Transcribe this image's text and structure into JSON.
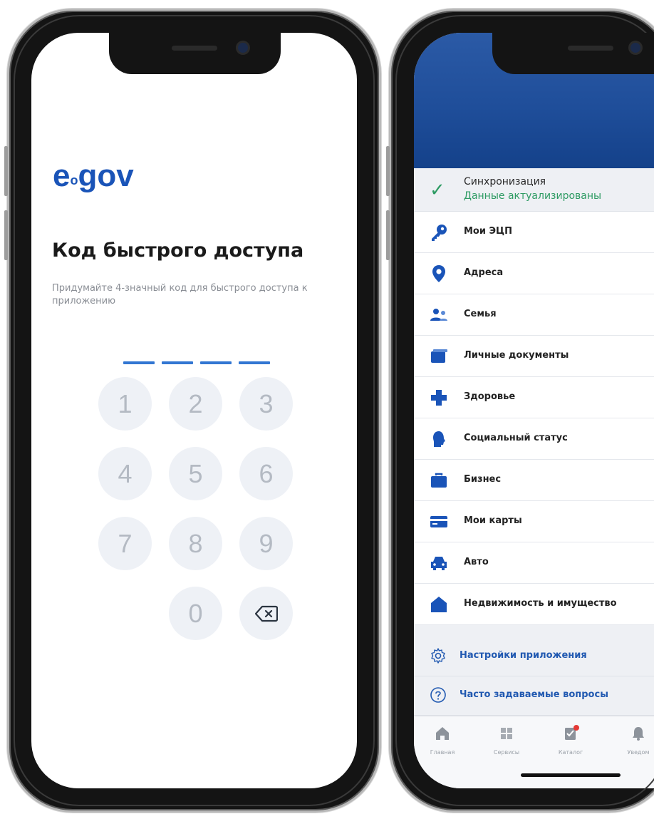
{
  "left_screen": {
    "logo_main": "e",
    "logo_sub": "o",
    "logo_tail": "gov",
    "title": "Код быстрого доступа",
    "description": "Придумайте 4-значный код для быстрого доступа к приложению",
    "pin_length": 4,
    "keypad": {
      "k1": "1",
      "k2": "2",
      "k3": "3",
      "k4": "4",
      "k5": "5",
      "k6": "6",
      "k7": "7",
      "k8": "8",
      "k9": "9",
      "k0": "0",
      "backspace_icon": "backspace-icon"
    },
    "colors": {
      "accent": "#1a54b8",
      "dash": "#3276d2",
      "key_bg": "#eef1f6",
      "key_text": "#b4bac3"
    }
  },
  "right_screen": {
    "sync": {
      "title": "Синхронизация",
      "status": "Данные актуализированы",
      "icon": "check-icon",
      "status_color": "#2e9b63"
    },
    "menu": [
      {
        "label": "Мои ЭЦП",
        "icon": "key-icon"
      },
      {
        "label": "Адреса",
        "icon": "location-pin-icon"
      },
      {
        "label": "Семья",
        "icon": "family-icon"
      },
      {
        "label": "Личные документы",
        "icon": "documents-icon"
      },
      {
        "label": "Здоровье",
        "icon": "health-cross-icon"
      },
      {
        "label": "Социальный статус",
        "icon": "social-status-icon"
      },
      {
        "label": "Бизнес",
        "icon": "briefcase-icon"
      },
      {
        "label": "Мои карты",
        "icon": "card-icon"
      },
      {
        "label": "Авто",
        "icon": "car-icon"
      },
      {
        "label": "Недвижимость и имущество",
        "icon": "house-icon"
      }
    ],
    "settings": [
      {
        "label": "Настройки приложения",
        "icon": "gear-icon"
      },
      {
        "label": "Часто задаваемые вопросы",
        "icon": "question-icon"
      }
    ],
    "tabs": [
      {
        "label": "Главная",
        "icon": "home-icon"
      },
      {
        "label": "Сервисы",
        "icon": "grid-icon"
      },
      {
        "label": "Каталог",
        "icon": "catalog-icon",
        "badge": true
      },
      {
        "label": "Уведом",
        "icon": "bell-icon"
      }
    ],
    "colors": {
      "header": "#1f4e9a",
      "accent": "#1a54b8",
      "badge": "#e53935"
    }
  }
}
